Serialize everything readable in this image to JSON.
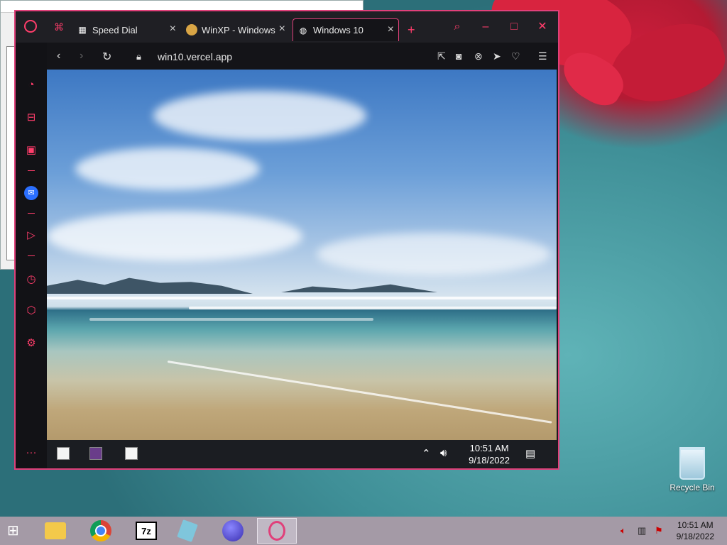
{
  "browser": {
    "tabs": [
      {
        "label": "Speed Dial",
        "icon": "grid-icon"
      },
      {
        "label": "WinXP - Windows",
        "icon": "doge-icon"
      },
      {
        "label": "Windows 10",
        "icon": "globe-icon"
      }
    ],
    "url": "win10.vercel.app"
  },
  "win10_taskbar": {
    "time": "10:51 AM",
    "date": "9/18/2022"
  },
  "desktop": {
    "recycle_bin_label": "Recycle Bin"
  },
  "taskbar": {
    "time": "10:51 AM",
    "date": "9/18/2022",
    "apps": [
      "file-explorer",
      "chrome",
      "7-zip",
      "notepad",
      "virus-app",
      "opera"
    ]
  },
  "colors": {
    "accent": "#e0407a",
    "opera_red": "#ff3d6b",
    "taskbar": "#a49aa6"
  }
}
